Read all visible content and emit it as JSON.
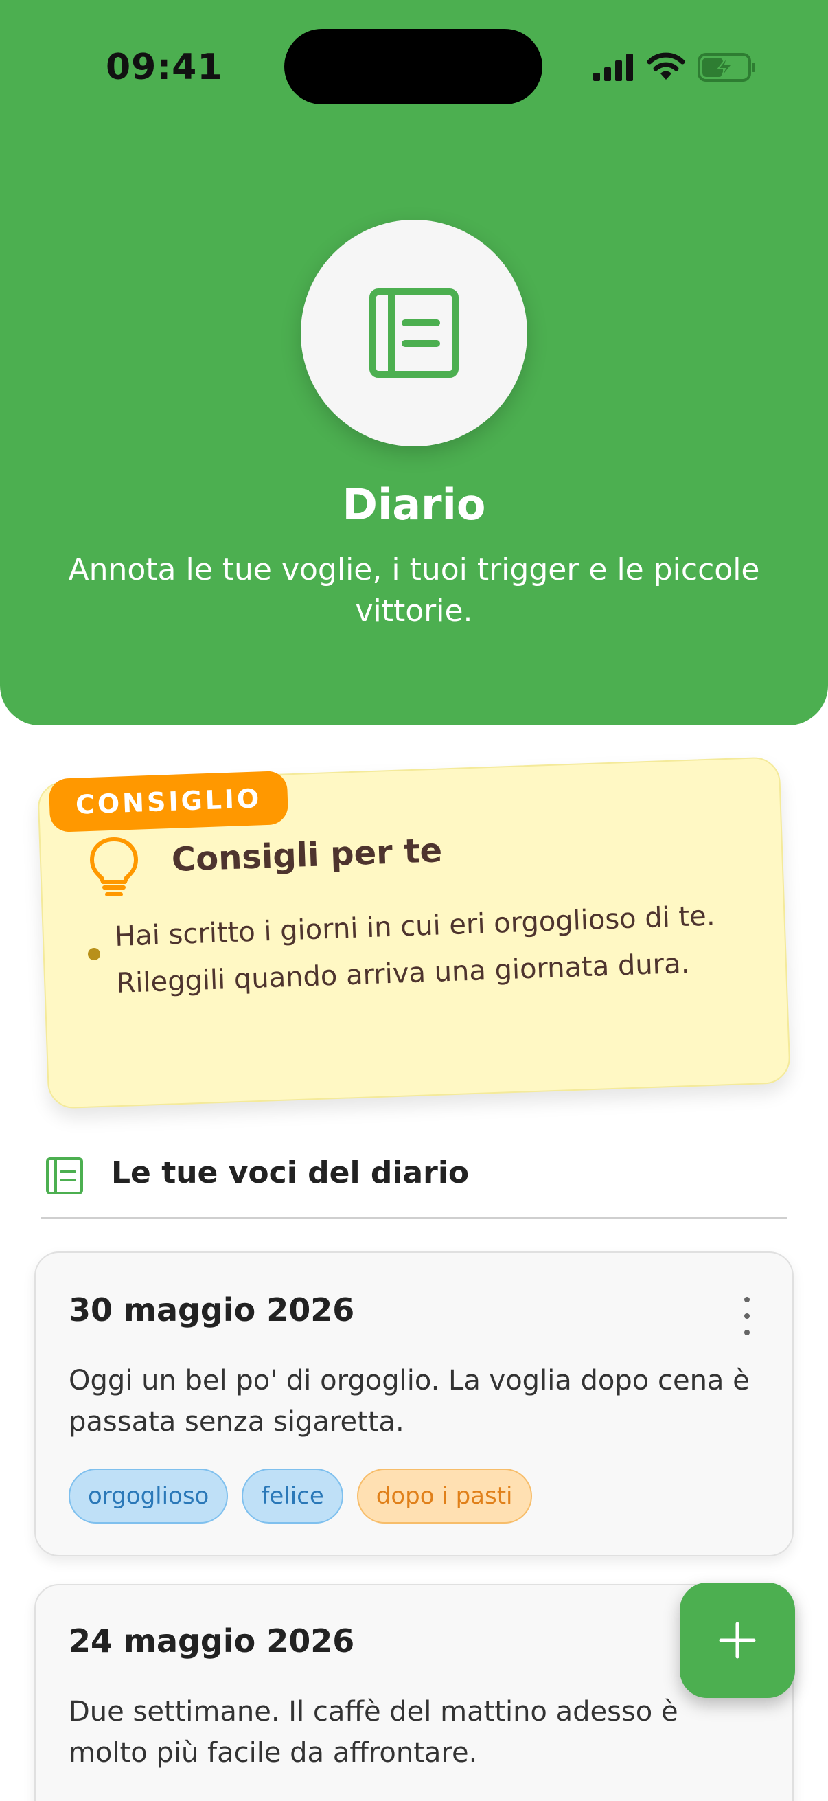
{
  "status_bar": {
    "time": "09:41"
  },
  "header": {
    "title": "Diario",
    "subtitle": "Annota le tue voglie, i tuoi trigger e le piccole vittorie.",
    "icon": "journal-icon",
    "background_color": "#4caf50"
  },
  "tip_card": {
    "badge": "CONSIGLIO",
    "title": "Consigli per te",
    "icon": "lightbulb-icon",
    "items": [
      "Hai scritto i giorni in cui eri orgoglioso di te. Rileggili quando arriva una giornata dura."
    ]
  },
  "journal_section": {
    "title": "Le tue voci del diario",
    "icon": "journal-icon"
  },
  "entries": [
    {
      "date": "30 maggio 2026",
      "text": "Oggi un bel po' di orgoglio. La voglia dopo cena è passata senza sigaretta.",
      "tags": [
        {
          "label": "orgoglioso",
          "color": "blue"
        },
        {
          "label": "felice",
          "color": "blue"
        },
        {
          "label": "dopo i pasti",
          "color": "orange"
        }
      ]
    },
    {
      "date": "24 maggio 2026",
      "text": "Due settimane. Il caffè del mattino adesso è molto più facile da affrontare.",
      "tags": []
    }
  ],
  "fab": {
    "icon": "plus-icon"
  }
}
